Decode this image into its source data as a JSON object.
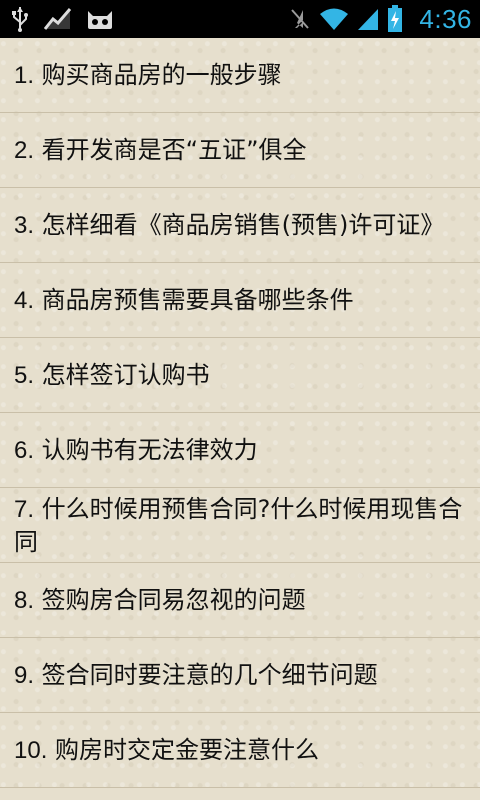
{
  "status_bar": {
    "time": "4:36",
    "left_icons": [
      "usb-icon",
      "activity-chart-icon",
      "cyanogen-bot-icon"
    ],
    "right_icons": [
      "vibrate-off-icon",
      "wifi-icon",
      "signal-icon",
      "battery-charging-icon"
    ],
    "time_color": "#33b5e5"
  },
  "list": {
    "items": [
      {
        "num": "1.",
        "text": "购买商品房的一般步骤"
      },
      {
        "num": "2.",
        "text": "看开发商是否“五证”俱全"
      },
      {
        "num": "3.",
        "text": "怎样细看《商品房销售(预售)许可证》"
      },
      {
        "num": "4.",
        "text": "商品房预售需要具备哪些条件"
      },
      {
        "num": "5.",
        "text": "怎样签订认购书"
      },
      {
        "num": "6.",
        "text": "认购书有无法律效力"
      },
      {
        "num": "7.",
        "text": "什么时候用预售合同?什么时候用现售合同"
      },
      {
        "num": "8.",
        "text": "签购房合同易忽视的问题"
      },
      {
        "num": "9.",
        "text": "签合同时要注意的几个细节问题"
      },
      {
        "num": "10.",
        "text": "购房时交定金要注意什么"
      }
    ]
  }
}
